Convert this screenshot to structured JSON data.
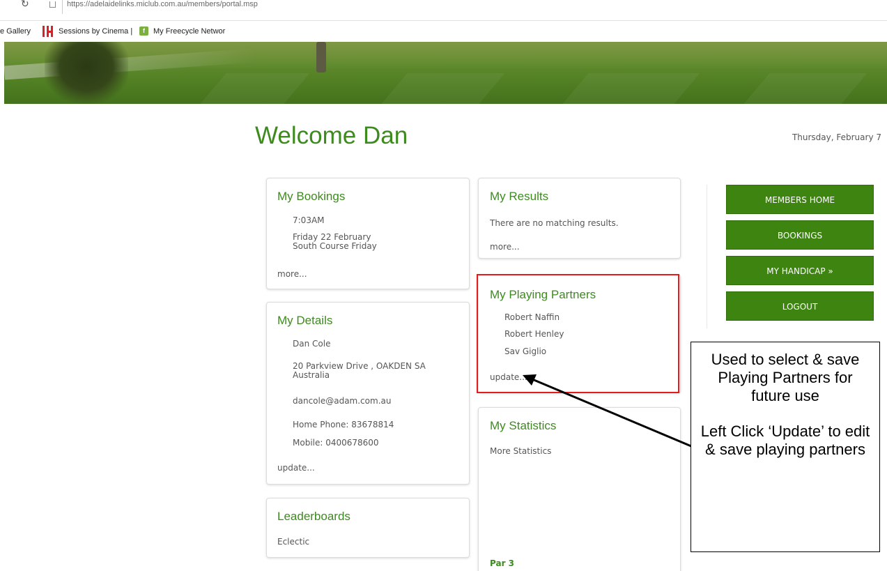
{
  "browser": {
    "url": "https://adelaidelinks.miclub.com.au/members/portal.msp",
    "bookmarks": [
      "e Gallery",
      "Sessions by Cinema |",
      "My Freecycle Networ"
    ]
  },
  "header": {
    "welcome": "Welcome Dan",
    "date": "Thursday, February 7"
  },
  "bookings": {
    "title": "My Bookings",
    "time": "7:03AM",
    "date": "Friday 22 February",
    "course": "South Course Friday",
    "more": "more..."
  },
  "details": {
    "title": "My Details",
    "name": "Dan Cole",
    "address1": "20 Parkview Drive , OAKDEN SA",
    "address2": "Australia",
    "email": "dancole@adam.com.au",
    "home_phone": "Home Phone: 83678814",
    "mobile": "Mobile: 0400678600",
    "update": "update..."
  },
  "leaderboards": {
    "title": "Leaderboards",
    "item": "Eclectic"
  },
  "results": {
    "title": "My Results",
    "message": "There are no matching results.",
    "more": "more..."
  },
  "partners": {
    "title": "My Playing Partners",
    "names": [
      "Robert Naffin",
      "Robert Henley",
      "Sav Giglio"
    ],
    "update": "update..."
  },
  "statistics": {
    "title": "My Statistics",
    "more": "More Statistics",
    "par": "Par 3"
  },
  "nav": {
    "buttons": [
      "MEMBERS HOME",
      "BOOKINGS",
      "MY HANDICAP »",
      "LOGOUT"
    ]
  },
  "annotation": {
    "line1": "Used to select & save Playing Partners for future use",
    "line2": "Left Click ‘Update’ to edit & save playing partners",
    "highlight_color": "#e41b1b"
  },
  "colors": {
    "accent_green": "#3d8b1f",
    "button_green": "#3d8410"
  }
}
